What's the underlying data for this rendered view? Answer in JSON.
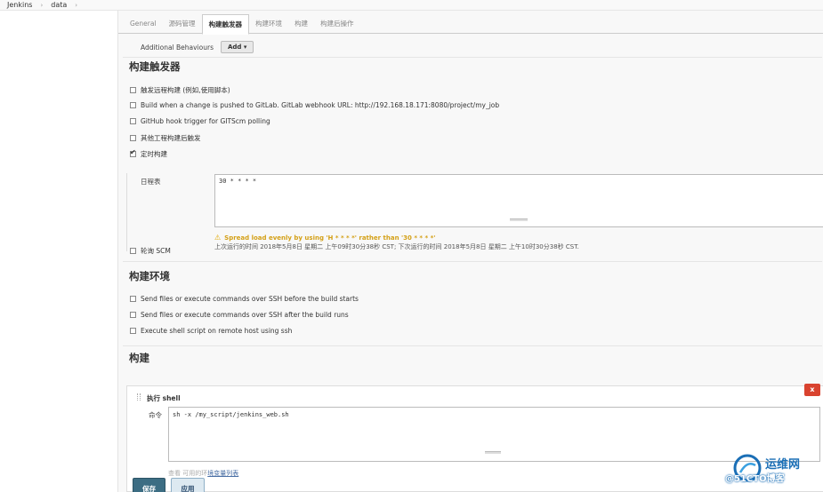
{
  "breadcrumb": {
    "items": [
      "Jenkins",
      "data"
    ]
  },
  "tabs": [
    "General",
    "源码管理",
    "构建触发器",
    "构建环境",
    "构建",
    "构建后操作"
  ],
  "scm": {
    "additional_behaviours_label": "Additional Behaviours",
    "add_button": "Add ▾"
  },
  "triggers": {
    "title": "构建触发器",
    "options": [
      {
        "label": "触发远程构建 (例如,使用脚本)",
        "checked": false
      },
      {
        "label": "Build when a change is pushed to GitLab. GitLab webhook URL: http://192.168.18.171:8080/project/my_job",
        "checked": false
      },
      {
        "label": "GitHub hook trigger for GITScm polling",
        "checked": false
      },
      {
        "label": "其他工程构建后触发",
        "checked": false
      },
      {
        "label": "定时构建",
        "checked": true
      }
    ],
    "schedule_label": "日程表",
    "schedule_value": "30 * * * *",
    "warning": "Spread load evenly by using 'H * * * *' rather than '30 * * * *'",
    "last_next_run": "上次运行的时间 2018年5月8日 星期二 上午09时30分38秒 CST; 下次运行的时间 2018年5月8日 星期二 上午10时30分38秒 CST.",
    "poll_scm": {
      "label": "轮询 SCM",
      "checked": false
    }
  },
  "build_env": {
    "title": "构建环境",
    "options": [
      {
        "label": "Send files or execute commands over SSH before the build starts",
        "checked": false
      },
      {
        "label": "Send files or execute commands over SSH after the build runs",
        "checked": false
      },
      {
        "label": "Execute shell script on remote host using ssh",
        "checked": false
      }
    ]
  },
  "build": {
    "title": "构建",
    "step_title": "执行 shell",
    "delete_label": "x",
    "command_label": "命令",
    "command_value": "sh -x /my_script/jenkins_web.sh",
    "env_link_prefix": "查看",
    "env_link_faint": "可用的环",
    "env_link": "境变量列表"
  },
  "footer": {
    "save": "保存",
    "apply": "应用"
  },
  "watermark": {
    "line1": "运维网",
    "line2": "@51CTO博客"
  },
  "colors": {
    "save_bg": "#3c6d83",
    "apply_bg": "#dde9f1",
    "delete_bg": "#d9432f",
    "warning": "#d4a017",
    "link": "#4a6fa5"
  }
}
